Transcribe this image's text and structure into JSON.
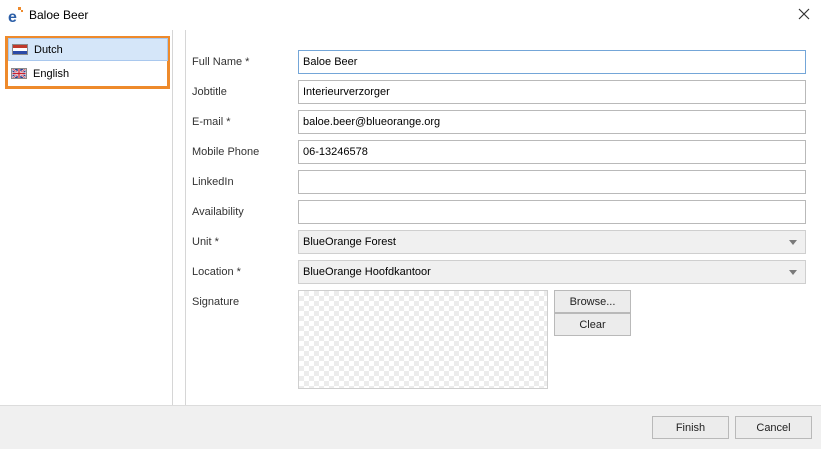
{
  "window": {
    "title": "Baloe Beer",
    "app_icon": "e",
    "close_icon": "close-icon"
  },
  "languages": [
    {
      "label": "Dutch",
      "flag": "flag-nl-icon",
      "selected": true
    },
    {
      "label": "English",
      "flag": "flag-uk-icon",
      "selected": false
    }
  ],
  "form": {
    "full_name": {
      "label": "Full Name *",
      "value": "Baloe Beer"
    },
    "jobtitle": {
      "label": "Jobtitle",
      "value": "Interieurverzorger"
    },
    "email": {
      "label": "E-mail *",
      "value": "baloe.beer@blueorange.org"
    },
    "mobile": {
      "label": "Mobile Phone",
      "value": "06-13246578"
    },
    "linkedin": {
      "label": "LinkedIn",
      "value": ""
    },
    "availability": {
      "label": "Availability",
      "value": ""
    },
    "unit": {
      "label": "Unit *",
      "value": "BlueOrange Forest"
    },
    "location": {
      "label": "Location *",
      "value": "BlueOrange Hoofdkantoor"
    },
    "signature": {
      "label": "Signature",
      "browse_label": "Browse...",
      "clear_label": "Clear"
    }
  },
  "footer": {
    "finish_label": "Finish",
    "cancel_label": "Cancel"
  },
  "colors": {
    "highlight_border": "#ee8a2b",
    "selected_bg": "#d5e6f9",
    "focus_border": "#74a6d8"
  }
}
